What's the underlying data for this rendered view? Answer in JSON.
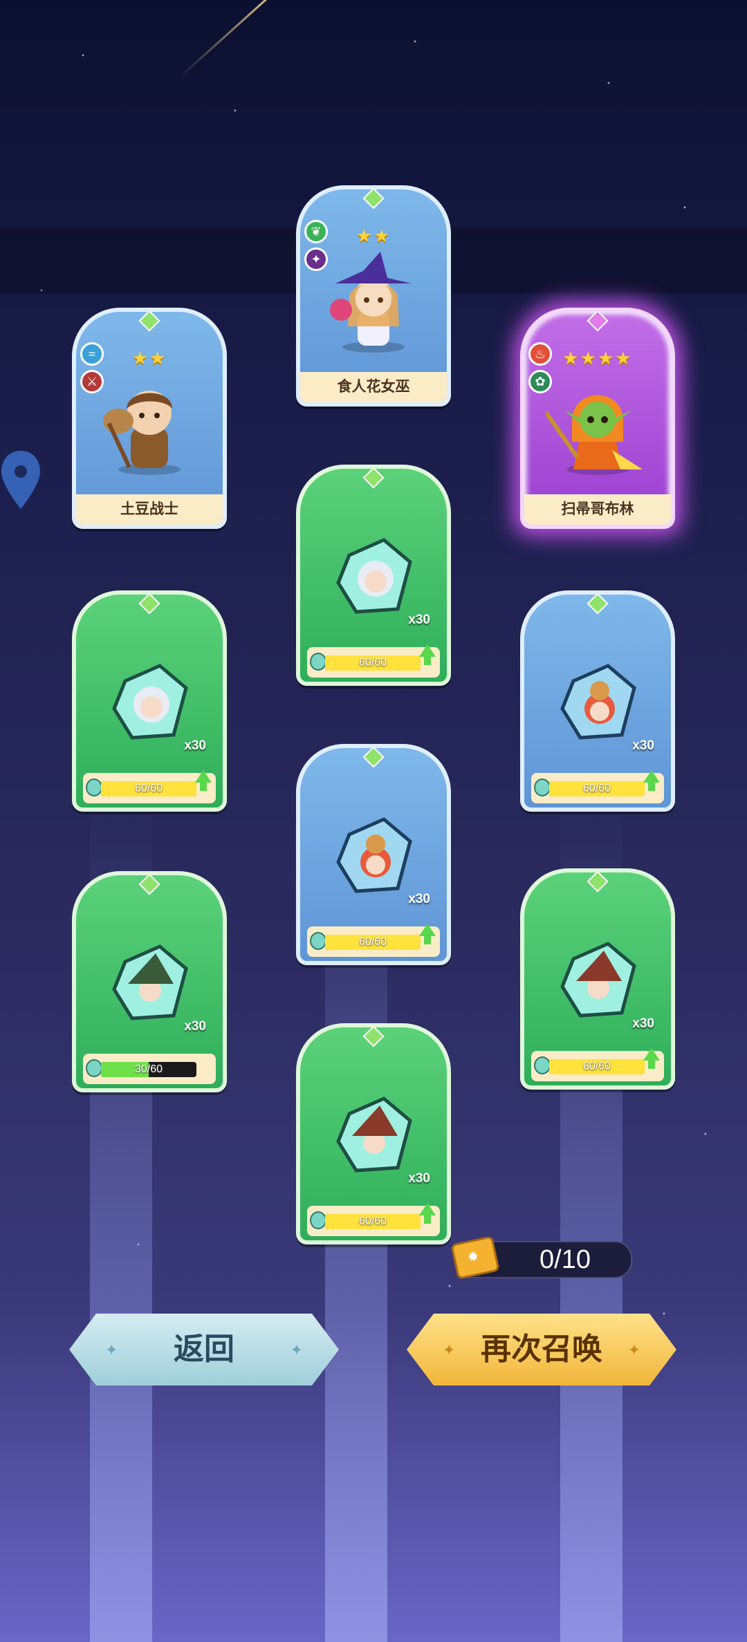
{
  "heroes": [
    {
      "name": "土豆战士",
      "stars": "★★",
      "rarity": "blue"
    },
    {
      "name": "食人花女巫",
      "stars": "★★",
      "rarity": "blue"
    },
    {
      "name": "扫帚哥布林",
      "stars": "★★★★",
      "rarity": "purple"
    }
  ],
  "shards": [
    {
      "count": "x30",
      "progress": "60/60",
      "fill": 1.0,
      "color": "green",
      "hair": "white"
    },
    {
      "count": "x30",
      "progress": "60/60",
      "fill": 1.0,
      "color": "green",
      "hair": "white"
    },
    {
      "count": "x30",
      "progress": "60/60",
      "fill": 1.0,
      "color": "blue",
      "hair": "bear"
    },
    {
      "count": "x30",
      "progress": "60/60",
      "fill": 1.0,
      "color": "blue",
      "hair": "bear"
    },
    {
      "count": "x30",
      "progress": "30/60",
      "fill": 0.5,
      "color": "green",
      "hair": "witch"
    },
    {
      "count": "x30",
      "progress": "60/60",
      "fill": 1.0,
      "color": "green",
      "hair": "witch-red"
    },
    {
      "count": "x30",
      "progress": "60/60",
      "fill": 1.0,
      "color": "green",
      "hair": "witch-red"
    }
  ],
  "ticket": {
    "value": "0/10"
  },
  "buttons": {
    "back": "返回",
    "summon_again": "再次召唤"
  }
}
